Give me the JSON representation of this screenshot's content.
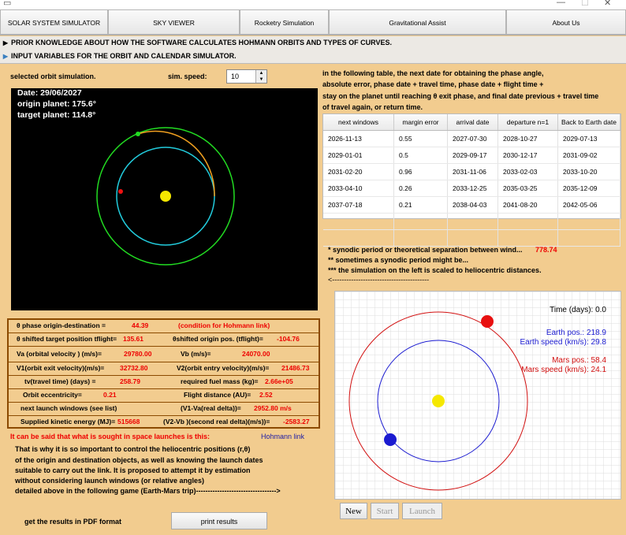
{
  "nav": {
    "tabs": [
      "SOLAR SYSTEM SIMULATOR",
      "SKY VIEWER",
      "Rocketry Simulation",
      "Gravitational Assist",
      "About Us"
    ]
  },
  "sections": {
    "prior_knowledge": "PRIOR KNOWLEDGE ABOUT HOW THE SOFTWARE CALCULATES HOHMANN ORBITS AND TYPES OF CURVES.",
    "input_vars": "INPUT VARIABLES FOR THE ORBIT AND CALENDAR SIMULATOR."
  },
  "controls": {
    "selected_orbit": "selected orbit simulation.",
    "sim_speed_label": "sim. speed:",
    "sim_speed_value": "10"
  },
  "orbit_panel": {
    "date": "Date: 29/06/2027",
    "origin": "origin planet: 175.6°",
    "target": "target planet: 114.8°"
  },
  "table_intro": [
    "in the following table, the next date for obtaining the phase angle,",
    "absolute error, phase date + travel time, phase date + flight time +",
    "stay on the planet until reaching θ exit phase, and final date previous + travel time",
    " of travel again, or return time."
  ],
  "table": {
    "headers": [
      "next windows",
      "margin error",
      "arrival date",
      "departure n=1",
      "Back to Earth date"
    ],
    "rows": [
      [
        "2026-11-13",
        "0.55",
        "2027-07-30",
        "2028-10-27",
        "2029-07-13"
      ],
      [
        "2029-01-01",
        "0.5",
        "2029-09-17",
        "2030-12-17",
        "2031-09-02"
      ],
      [
        "2031-02-20",
        "0.96",
        "2031-11-06",
        "2033-02-03",
        "2033-10-20"
      ],
      [
        "2033-04-10",
        "0.26",
        "2033-12-25",
        "2035-03-25",
        "2035-12-09"
      ],
      [
        "2037-07-18",
        "0.21",
        "2038-04-03",
        "2041-08-20",
        "2042-05-06"
      ],
      [
        "",
        "",
        "",
        "",
        ""
      ],
      [
        "",
        "",
        "",
        "",
        ""
      ]
    ]
  },
  "notes": {
    "synodic": " * synodic period or theoretical separation between wind...",
    "synodic_value": "778.74",
    "sometimes": "  ** sometimes a synodic period might be...",
    "scaled": "*** the simulation on the left is scaled to heliocentric distances.",
    "arrow": "<-----------------------------------------"
  },
  "data_box": {
    "phase_label": "θ phase origin-destination =",
    "phase_value": "44.39",
    "phase_cond": "(condition for Hohmann link)",
    "shifted_target_label": "θ shifted target position tflight=",
    "shifted_target_value": "135.61",
    "shifted_origin_label": "θshifted origin pos. (tflight)=",
    "shifted_origin_value": "-104.76",
    "va_label": "Va (orbital  velocity ) (m/s)=",
    "va_value": "29780.00",
    "vb_label": "Vb (m/s)=",
    "vb_value": "24070.00",
    "v1_label": "V1(orbit exit velocity)(m/s)=",
    "v1_value": "32732.80",
    "v2_label": "V2(orbit entry velocity)(m/s)=",
    "v2_value": "21486.73",
    "tv_label": "tv(travel time) (days) =",
    "tv_value": "258.79",
    "fuel_label": "required fuel mass (kg)=",
    "fuel_value": "2.66e+05",
    "ecc_label": "Orbit eccentricity=",
    "ecc_value": "0.21",
    "dist_label": "Flight distance (AU)=",
    "dist_value": "2.52",
    "launch_label": "next launch windows (see list)",
    "delta1_label": "(V1-Va(real delta))=",
    "delta1_value": "2952.80 m/s",
    "ke_label": "Supplied kinetic energy (MJ)=",
    "ke_value": "515668",
    "delta2_label": "(V2-Vb )(second real delta)(m/s))=",
    "delta2_value": "-2583.27"
  },
  "bottom_text": {
    "highlight": "It can be said that what is sought in space launches is this:",
    "hohmann_link": "Hohmann link",
    "lines": [
      "That is why it is so important to control the heliocentric positions (r,θ)",
      "of the origin and destination objects, as well as knowing the launch dates",
      "suitable to carry out the link. It is proposed to attempt it by estimation",
      "without considering launch windows (or relative angles)",
      "detailed above in the following game (Earth-Mars trip)---------------------------------->"
    ],
    "pdf_label": "get the results in PDF format",
    "print_button": "print results"
  },
  "sim": {
    "time": "Time (days): 0.0",
    "earth_pos": "Earth pos.: 218.9",
    "earth_speed": "Earth speed (km/s): 29.8",
    "mars_pos": "Mars pos.: 58.4",
    "mars_speed": "Mars speed (km/s): 24.1",
    "buttons": [
      "New",
      "Start",
      "Launch"
    ]
  },
  "colors": {
    "background": "#f2cc8f",
    "earth": "#1a1ad0",
    "mars": "#e81010",
    "sun": "#f5e800",
    "transfer": "#f0a020"
  }
}
